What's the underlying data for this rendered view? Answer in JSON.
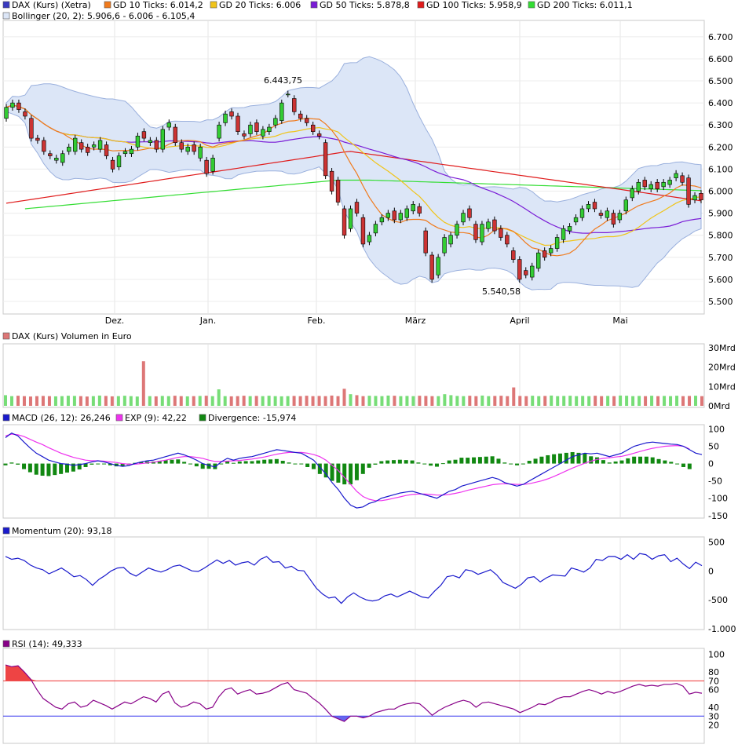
{
  "colors": {
    "up": "#33cc33",
    "down": "#cc3333",
    "bollinger_fill": "#dce6f7",
    "bollinger_line": "#9ab0dd",
    "gd10": "#f07a1c",
    "gd20": "#f0c419",
    "gd50": "#7a1cd6",
    "gd100": "#e01b1b",
    "gd200": "#33dd33",
    "macd": "#1a1acc",
    "exp": "#ee33ee",
    "divergence": "#118811",
    "momentum": "#1a1acc",
    "rsi": "#880088",
    "rsi70": "#ee3333",
    "rsi30": "#3333ee",
    "vol_up": "#77dd77",
    "vol_down": "#dd7777"
  },
  "legend": {
    "kurs": "DAX (Kurs) (Xetra)",
    "gd10": "GD 10 Ticks: 6.014,2",
    "gd20": "GD 20 Ticks: 6.006",
    "gd50": "GD 50 Ticks: 5.878,8",
    "gd100": "GD 100 Ticks: 5.958,9",
    "gd200": "GD 200 Ticks: 6.011,1",
    "bollinger": "Bollinger (20, 2): 5.906,6 - 6.006 - 6.105,4",
    "volume": "DAX (Kurs) Volumen in Euro",
    "macd": "MACD (26, 12): 26,246",
    "exp": "EXP (9): 42,22",
    "divergence": "Divergence: -15,974",
    "momentum": "Momentum (20): 93,18",
    "rsi": "RSI (14): 49,333"
  },
  "months": [
    "Dez.",
    "Jan.",
    "Feb.",
    "März",
    "April",
    "Mai"
  ],
  "annotations": {
    "high": "6.443,75",
    "low": "5.540,58"
  },
  "chart_data": [
    {
      "type": "candlestick",
      "title": "DAX (Kurs) (Xetra)",
      "ylim": [
        5450,
        6760
      ],
      "yticks": [
        "6.700",
        "6.600",
        "6.500",
        "6.400",
        "6.300",
        "6.200",
        "6.100",
        "6.000",
        "5.900",
        "5.800",
        "5.700",
        "5.600",
        "5.500"
      ],
      "ytick_values": [
        6700,
        6600,
        6500,
        6400,
        6300,
        6200,
        6100,
        6000,
        5900,
        5800,
        5700,
        5600,
        5500
      ],
      "series": [
        {
          "name": "DAX (Kurs) (Xetra)",
          "close": [
            6380,
            6400,
            6370,
            6340,
            6240,
            6230,
            6180,
            6160,
            6150,
            6170,
            6200,
            6240,
            6190,
            6175,
            6210,
            6230,
            6160,
            6100,
            6160,
            6180,
            6190,
            6250,
            6240,
            6230,
            6190,
            6280,
            6310,
            6220,
            6190,
            6200,
            6180,
            6200,
            6080,
            6150,
            6300,
            6350,
            6340,
            6270,
            6250,
            6300,
            6270,
            6280,
            6290,
            6330,
            6400,
            6440,
            6360,
            6330,
            6310,
            6270,
            6250,
            6070,
            6000,
            5950,
            5800,
            5920,
            5900,
            5760,
            5800,
            5850,
            5880,
            5900,
            5870,
            5900,
            5920,
            5940,
            5900,
            5720,
            5600,
            5700,
            5790,
            5800,
            5850,
            5900,
            5880,
            5780,
            5850,
            5860,
            5820,
            5790,
            5760,
            5690,
            5600,
            5620,
            5660,
            5720,
            5700,
            5740,
            5790,
            5830,
            5840,
            5880,
            5920,
            5940,
            5920,
            5890,
            5910,
            5850,
            5900,
            5960,
            6010,
            6040,
            6020,
            6030,
            6010,
            6040,
            6050,
            6080,
            6040,
            5940,
            5980,
            5960
          ],
          "open": [
            6330,
            6380,
            6400,
            6360,
            6330,
            6240,
            6230,
            6170,
            6140,
            6130,
            6180,
            6180,
            6220,
            6200,
            6200,
            6190,
            6210,
            6140,
            6110,
            6170,
            6170,
            6200,
            6270,
            6220,
            6230,
            6190,
            6290,
            6290,
            6220,
            6180,
            6210,
            6150,
            6140,
            6090,
            6240,
            6310,
            6360,
            6340,
            6260,
            6260,
            6310,
            6250,
            6270,
            6300,
            6320,
            6440,
            6420,
            6350,
            6330,
            6300,
            6260,
            6220,
            6090,
            6050,
            5920,
            5830,
            5950,
            5880,
            5770,
            5810,
            5860,
            5880,
            5910,
            5870,
            5880,
            5910,
            5930,
            5820,
            5710,
            5620,
            5720,
            5760,
            5800,
            5860,
            5920,
            5850,
            5770,
            5830,
            5870,
            5830,
            5800,
            5730,
            5690,
            5640,
            5610,
            5650,
            5730,
            5720,
            5740,
            5780,
            5820,
            5860,
            5880,
            5920,
            5950,
            5900,
            5880,
            5900,
            5870,
            5910,
            5970,
            6000,
            6050,
            6010,
            6040,
            6020,
            6030,
            6060,
            6070,
            6060,
            5960,
            5990
          ]
        }
      ]
    },
    {
      "type": "bar",
      "title": "DAX (Kurs) Volumen in Euro",
      "ylim": [
        0,
        32
      ],
      "yticks": [
        "30Mrd",
        "20Mrd",
        "10Mrd",
        "0Mrd"
      ],
      "ytick_values": [
        30,
        20,
        10,
        0
      ],
      "values": [
        5.5,
        5,
        5.2,
        5,
        4.8,
        5,
        5.1,
        5,
        4.9,
        5,
        5.2,
        5.1,
        5,
        4.8,
        5,
        5.3,
        5.1,
        4.9,
        5,
        5.2,
        5,
        4.8,
        23,
        5,
        4.9,
        5.1,
        5,
        5.2,
        5,
        4.9,
        5,
        5.1,
        5.2,
        5,
        8.5,
        5,
        4.9,
        5,
        5.2,
        5,
        5.1,
        5,
        5.2,
        5,
        4.9,
        5,
        5.1,
        5,
        5.2,
        5,
        5.1,
        5,
        5.3,
        5,
        8.8,
        6,
        5.5,
        5,
        5.2,
        5.1,
        5,
        5.3,
        5.2,
        5,
        5.1,
        5,
        5.2,
        5.1,
        5,
        5,
        6,
        5.5,
        5.1,
        5,
        5.2,
        5,
        5.3,
        5,
        5.1,
        5.2,
        5,
        9.5,
        5.1,
        5,
        5.2,
        5,
        5.1,
        5.3,
        5,
        5.1,
        5.2,
        5,
        5.1,
        5,
        5.2,
        5,
        5.1,
        5,
        5.3,
        5.2,
        5,
        5.1,
        5,
        5.2,
        5,
        5.1,
        5,
        5.2,
        5,
        5.1,
        5.2,
        5
      ]
    },
    {
      "type": "line",
      "title": "MACD (26, 12)",
      "ylim": [
        -155,
        110
      ],
      "yticks": [
        "100",
        "50",
        "0",
        "-50",
        "-100",
        "-150"
      ],
      "ytick_values": [
        100,
        50,
        0,
        -50,
        -100,
        -150
      ],
      "series": [
        {
          "name": "MACD (26, 12)",
          "values": [
            75,
            88,
            80,
            62,
            45,
            30,
            20,
            10,
            5,
            0,
            -2,
            -5,
            -3,
            0,
            5,
            8,
            5,
            0,
            -5,
            -8,
            -6,
            0,
            5,
            8,
            10,
            15,
            20,
            25,
            30,
            25,
            18,
            10,
            0,
            -5,
            -10,
            5,
            15,
            10,
            15,
            18,
            20,
            25,
            30,
            35,
            40,
            38,
            35,
            32,
            30,
            20,
            10,
            -10,
            -30,
            -55,
            -75,
            -100,
            -120,
            -128,
            -125,
            -115,
            -110,
            -100,
            -95,
            -90,
            -85,
            -82,
            -80,
            -85,
            -90,
            -95,
            -100,
            -90,
            -80,
            -75,
            -65,
            -60,
            -55,
            -50,
            -45,
            -40,
            -45,
            -55,
            -60,
            -65,
            -60,
            -50,
            -40,
            -30,
            -20,
            -10,
            0,
            10,
            20,
            25,
            30,
            28,
            30,
            25,
            20,
            25,
            30,
            40,
            50,
            55,
            60,
            62,
            60,
            58,
            56,
            55,
            50,
            40,
            30,
            26
          ]
        },
        {
          "name": "EXP (9)",
          "values": [
            80,
            85,
            83,
            78,
            70,
            62,
            55,
            46,
            38,
            30,
            24,
            18,
            14,
            10,
            8,
            8,
            7,
            5,
            3,
            0,
            -2,
            -2,
            0,
            2,
            4,
            7,
            10,
            14,
            18,
            20,
            20,
            18,
            15,
            10,
            6,
            6,
            7,
            8,
            9,
            11,
            13,
            16,
            19,
            23,
            27,
            30,
            32,
            32,
            32,
            30,
            26,
            20,
            10,
            -5,
            -20,
            -40,
            -60,
            -80,
            -95,
            -103,
            -107,
            -107,
            -104,
            -100,
            -96,
            -92,
            -89,
            -88,
            -88,
            -89,
            -91,
            -91,
            -89,
            -86,
            -82,
            -77,
            -73,
            -69,
            -65,
            -61,
            -59,
            -58,
            -59,
            -60,
            -60,
            -58,
            -54,
            -50,
            -44,
            -37,
            -29,
            -21,
            -13,
            -6,
            1,
            7,
            12,
            15,
            17,
            19,
            21,
            25,
            30,
            35,
            40,
            44,
            47,
            50,
            51,
            52,
            50,
            42
          ]
        },
        {
          "name": "Divergence",
          "values": [
            -5,
            3,
            -3,
            -16,
            -25,
            -32,
            -35,
            -36,
            -33,
            -30,
            -26,
            -23,
            -17,
            -10,
            -3,
            0,
            -2,
            -5,
            -8,
            -8,
            -4,
            2,
            5,
            6,
            6,
            8,
            10,
            11,
            12,
            5,
            -2,
            -8,
            -15,
            -15,
            -16,
            -1,
            8,
            2,
            6,
            7,
            7,
            9,
            11,
            12,
            13,
            8,
            3,
            0,
            -2,
            -10,
            -16,
            -30,
            -40,
            -50,
            -55,
            -60,
            -60,
            -48,
            -30,
            -12,
            -3,
            7,
            9,
            10,
            11,
            10,
            9,
            3,
            -2,
            -6,
            -9,
            1,
            9,
            11,
            17,
            17,
            18,
            19,
            20,
            21,
            14,
            3,
            -1,
            -5,
            0,
            8,
            14,
            20,
            24,
            27,
            29,
            31,
            33,
            31,
            29,
            21,
            18,
            10,
            3,
            6,
            9,
            15,
            20,
            20,
            20,
            18,
            13,
            9,
            5,
            0,
            -10,
            -16
          ]
        }
      ]
    },
    {
      "type": "line",
      "title": "Momentum (20)",
      "ylim": [
        -1000,
        560
      ],
      "yticks": [
        "500",
        "0",
        "-500",
        "-1.000"
      ],
      "ytick_values": [
        500,
        0,
        -500,
        -1000
      ],
      "series": [
        {
          "name": "Momentum (20)",
          "values": [
            250,
            200,
            220,
            180,
            100,
            50,
            20,
            -50,
            0,
            50,
            -20,
            -100,
            -80,
            -150,
            -250,
            -150,
            -80,
            0,
            50,
            60,
            -40,
            -90,
            -20,
            50,
            10,
            -20,
            20,
            80,
            100,
            50,
            0,
            -10,
            50,
            120,
            190,
            130,
            180,
            100,
            140,
            160,
            100,
            200,
            250,
            150,
            160,
            50,
            80,
            10,
            0,
            -150,
            -300,
            -400,
            -470,
            -450,
            -560,
            -450,
            -380,
            -450,
            -500,
            -520,
            -500,
            -430,
            -400,
            -450,
            -400,
            -350,
            -400,
            -450,
            -470,
            -350,
            -250,
            -100,
            -80,
            -120,
            20,
            0,
            -60,
            -20,
            20,
            -70,
            -200,
            -250,
            -300,
            -230,
            -120,
            -100,
            -190,
            -120,
            -70,
            -80,
            -90,
            50,
            20,
            -20,
            50,
            200,
            180,
            250,
            250,
            200,
            280,
            200,
            300,
            280,
            200,
            260,
            280,
            160,
            220,
            120,
            40,
            150,
            90
          ]
        }
      ]
    },
    {
      "type": "line",
      "title": "RSI (14)",
      "ylim": [
        0,
        105
      ],
      "yticks": [
        "100",
        "80",
        "70",
        "60",
        "40",
        "30",
        "20"
      ],
      "ytick_values": [
        100,
        80,
        70,
        60,
        40,
        30,
        20
      ],
      "series": [
        {
          "name": "RSI (14)",
          "values": [
            88,
            86,
            87,
            80,
            72,
            60,
            50,
            45,
            40,
            38,
            44,
            46,
            40,
            42,
            48,
            45,
            42,
            38,
            42,
            46,
            44,
            48,
            52,
            50,
            46,
            55,
            58,
            45,
            40,
            42,
            46,
            44,
            38,
            40,
            52,
            60,
            62,
            55,
            58,
            60,
            55,
            56,
            58,
            62,
            66,
            68,
            60,
            58,
            56,
            50,
            45,
            38,
            30,
            27,
            24,
            30,
            30,
            28,
            30,
            34,
            36,
            38,
            38,
            42,
            44,
            45,
            44,
            38,
            31,
            36,
            40,
            43,
            46,
            48,
            46,
            40,
            45,
            46,
            44,
            42,
            40,
            38,
            34,
            37,
            40,
            44,
            43,
            46,
            50,
            52,
            52,
            55,
            58,
            60,
            58,
            55,
            58,
            56,
            58,
            61,
            64,
            66,
            64,
            65,
            64,
            66,
            66,
            67,
            64,
            55,
            57,
            56
          ]
        }
      ]
    }
  ]
}
